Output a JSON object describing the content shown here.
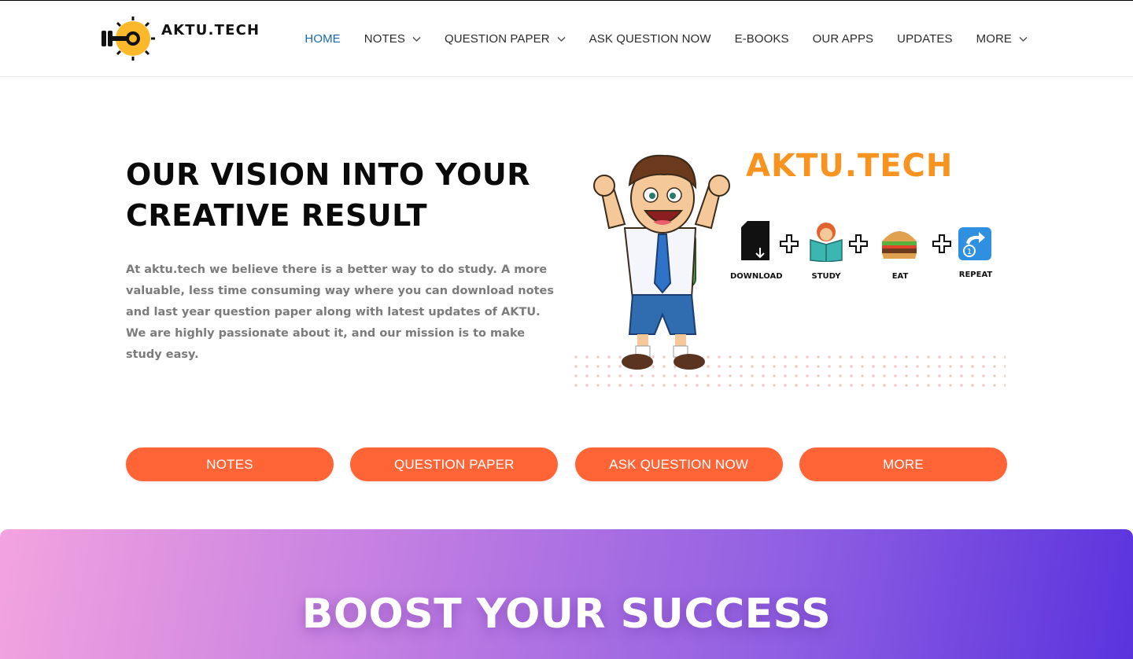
{
  "brand": {
    "name": "AKTU.TECH"
  },
  "nav": {
    "items": [
      {
        "label": "HOME",
        "active": true,
        "dropdown": false
      },
      {
        "label": "NOTES",
        "active": false,
        "dropdown": true
      },
      {
        "label": "QUESTION PAPER",
        "active": false,
        "dropdown": true
      },
      {
        "label": "ASK QUESTION NOW",
        "active": false,
        "dropdown": false
      },
      {
        "label": "E-BOOKS",
        "active": false,
        "dropdown": false
      },
      {
        "label": "OUR APPS",
        "active": false,
        "dropdown": false
      },
      {
        "label": "UPDATES",
        "active": false,
        "dropdown": false
      },
      {
        "label": "MORE",
        "active": false,
        "dropdown": true
      }
    ]
  },
  "hero": {
    "title_line1": "OUR VISION INTO YOUR",
    "title_line2": "CREATIVE RESULT",
    "text": "At aktu.tech we believe there is a better way to do study. A more valuable, less time consuming way where you can download notes and last year question paper along with latest updates of AKTU. We are highly passionate about it, and our mission is to make study easy."
  },
  "illustration": {
    "brand_word": "AKTU.TECH",
    "steps": [
      "DOWNLOAD",
      "STUDY",
      "EAT",
      "REPEAT"
    ]
  },
  "buttons": [
    "NOTES",
    "QUESTION PAPER",
    "ASK QUESTION NOW",
    "MORE"
  ],
  "boost": {
    "title": "BOOST YOUR SUCCESS"
  },
  "colors": {
    "accent": "#ff6436",
    "nav_active": "#1b66b0",
    "logo_yellow": "#fbb829",
    "brand_orange": "#f7931e"
  }
}
